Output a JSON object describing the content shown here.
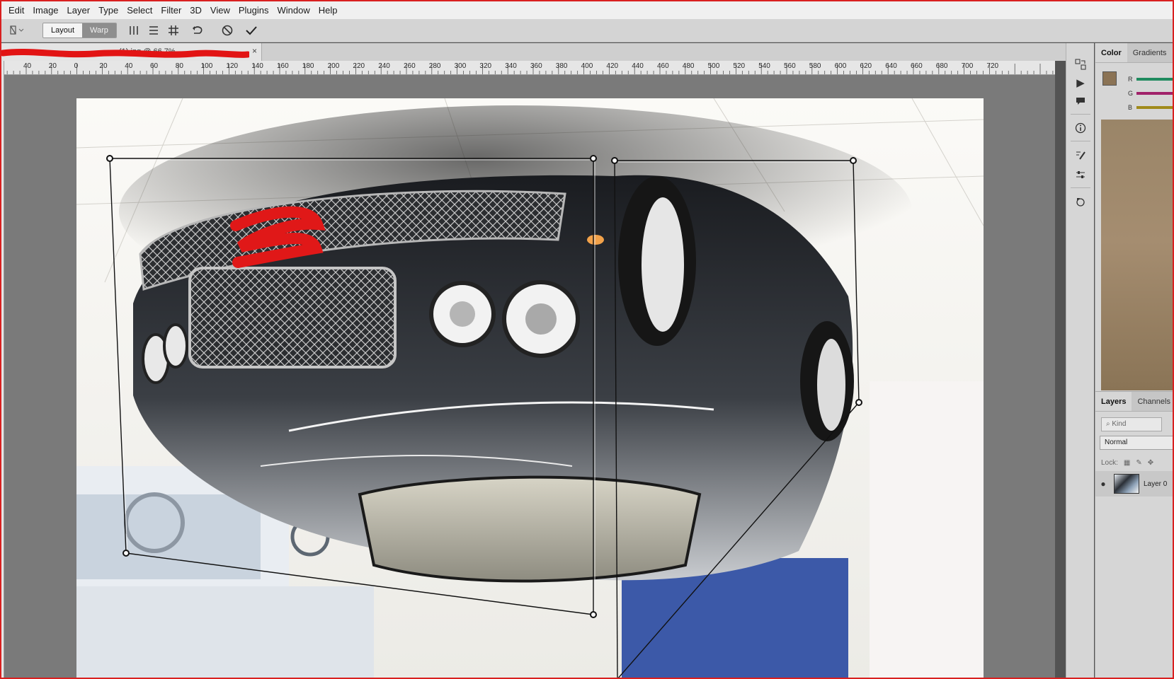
{
  "menu": {
    "items": [
      "Edit",
      "Image",
      "Layer",
      "Type",
      "Select",
      "Filter",
      "3D",
      "View",
      "Plugins",
      "Window",
      "Help"
    ]
  },
  "options_bar": {
    "tool_icon": "puppet-warp-icon",
    "mode_layout": "Layout",
    "mode_warp": "Warp",
    "icons": [
      "vertical-split-icon",
      "horizontal-split-icon",
      "grid-split-icon",
      "reset-warp-icon",
      "cancel-icon",
      "commit-icon"
    ]
  },
  "document": {
    "tab_title": "(1).jpg @ 66.7%",
    "close_label": "×"
  },
  "ruler": {
    "labels": [
      "40",
      "20",
      "0",
      "20",
      "40",
      "60",
      "80",
      "100",
      "120",
      "140",
      "160",
      "180",
      "200",
      "220",
      "240",
      "260",
      "280",
      "300",
      "320",
      "340",
      "360",
      "380",
      "400",
      "420",
      "440",
      "460",
      "480",
      "500",
      "520",
      "540",
      "560",
      "580",
      "600",
      "620",
      "640",
      "660",
      "680",
      "700",
      "720"
    ]
  },
  "panels": {
    "color_tabs": [
      "Color",
      "Gradients"
    ],
    "sliders": [
      "R",
      "G",
      "B"
    ],
    "foreground_color": "#8b7355",
    "background_color": "#ffffff",
    "layers_tabs": [
      "Layers",
      "Channels"
    ],
    "kind_placeholder": "Kind",
    "blend_mode": "Normal",
    "lock_label": "Lock:",
    "layer_name": "Layer 0"
  },
  "colors": {
    "accent_red": "#d92020",
    "ui_light": "#d6d6d6",
    "canvas_bg": "#7a7a7a"
  }
}
